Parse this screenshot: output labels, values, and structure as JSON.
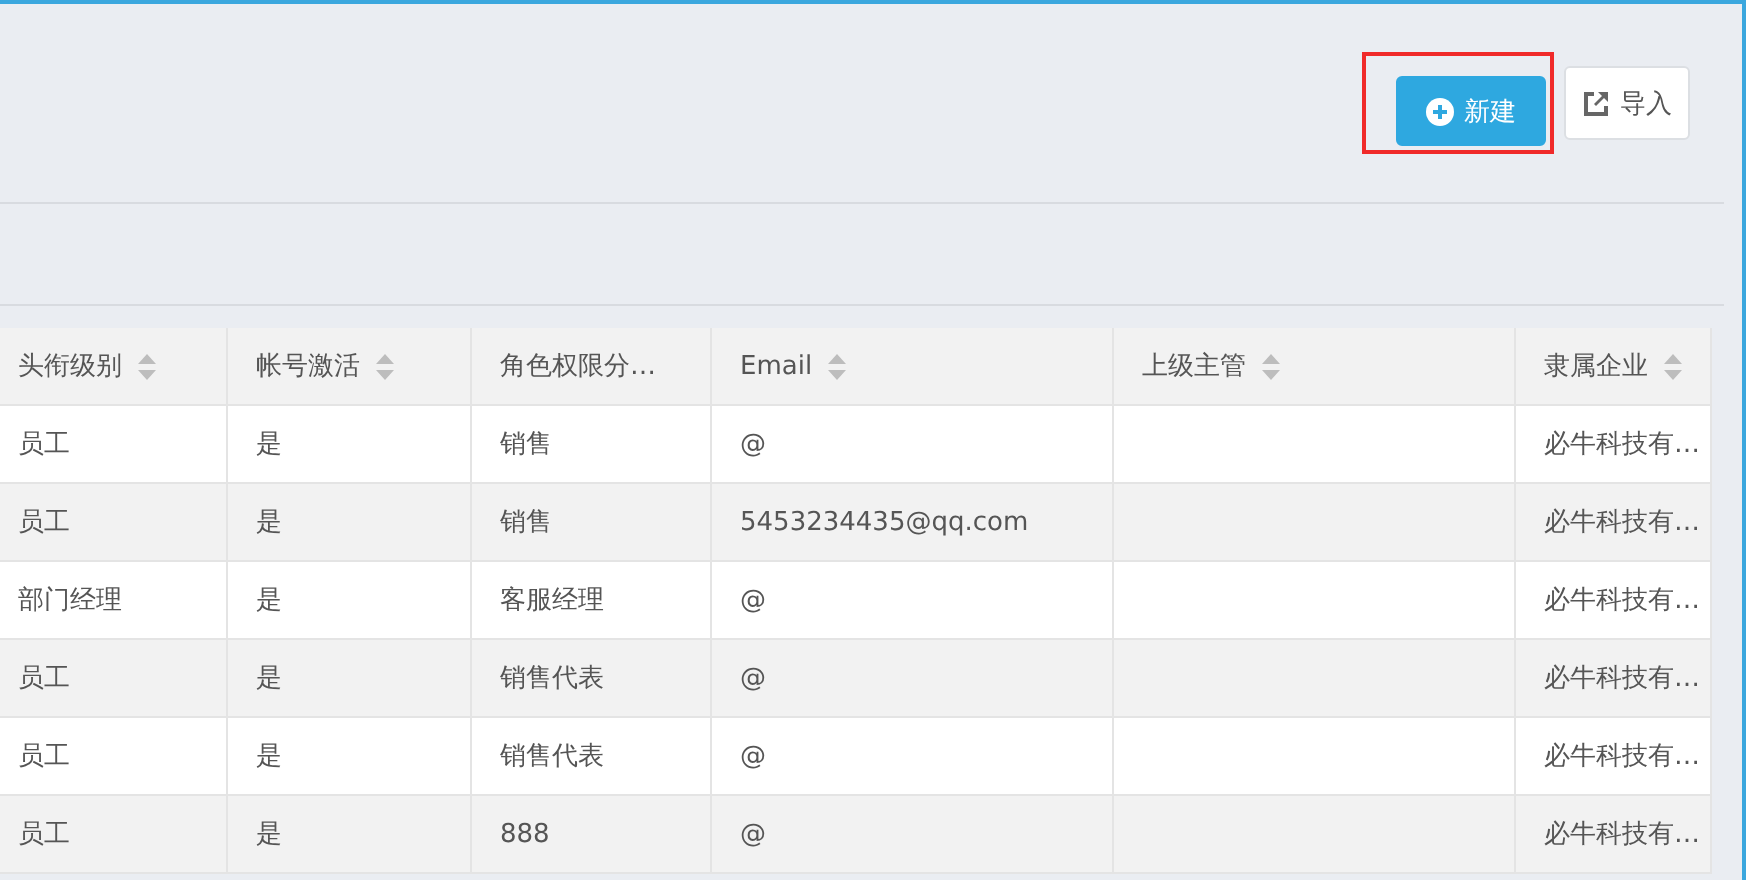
{
  "toolbar": {
    "buttons": [
      {
        "kind": "primary",
        "label": "新建",
        "highlighted": true
      },
      {
        "kind": "default",
        "label": "导入",
        "highlighted": false
      }
    ]
  },
  "table": {
    "columns": [
      {
        "label": "头衔级别",
        "sortable": true
      },
      {
        "label": "帐号激活",
        "sortable": true
      },
      {
        "label": "角色权限分…",
        "sortable": false
      },
      {
        "label": "Email",
        "sortable": true
      },
      {
        "label": "上级主管",
        "sortable": true
      },
      {
        "label": "隶属企业",
        "sortable": true
      }
    ],
    "rows": [
      {
        "rank": "员工",
        "active": "是",
        "role": "销售",
        "email": "@",
        "company": "必牛科技有…"
      },
      {
        "rank": "员工",
        "active": "是",
        "role": "销售",
        "email": "5453234435@qq.com",
        "company": "必牛科技有…"
      },
      {
        "rank": "部门经理",
        "active": "是",
        "role": "客服经理",
        "email": "@",
        "company": "必牛科技有…"
      },
      {
        "rank": "员工",
        "active": "是",
        "role": "销售代表",
        "email": "@",
        "company": "必牛科技有…"
      },
      {
        "rank": "员工",
        "active": "是",
        "role": "销售代表",
        "email": "@",
        "company": "必牛科技有…"
      },
      {
        "rank": "员工",
        "active": "是",
        "role": "888",
        "email": "@",
        "company": "必牛科技有…"
      }
    ]
  }
}
